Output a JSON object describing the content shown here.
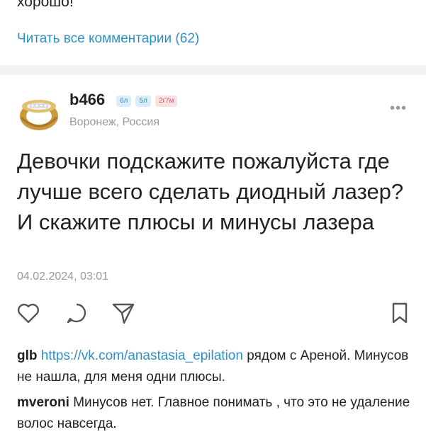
{
  "prev_post": {
    "comment_tail": "хорошо!",
    "read_all": "Читать все комментарии (62)"
  },
  "post": {
    "username": "b466",
    "badges": [
      "6л",
      "5л",
      "2г7м"
    ],
    "location": "Воронеж, Россия",
    "more_icon": "more-dots-icon",
    "text": "Девочки подскажите пожалуйста где лучше всего сделать диодный лазер? И скажите плюсы и минусы лазера",
    "date": "04.02.2024, 03:01",
    "actions": {
      "like_icon": "heart-icon",
      "comment_icon": "speech-bubble-icon",
      "share_icon": "send-icon",
      "bookmark_icon": "bookmark-icon"
    }
  },
  "comments": [
    {
      "author": "glb",
      "link": "https://vk.com/anastasia_epilation",
      "text": " рядом с Ареной. Минусов не нашла, для меня одни плюсы."
    },
    {
      "author": "mveroni",
      "text": " Минусов нет. Главное понимать , что это не удаление волос навсегда."
    }
  ],
  "colors": {
    "link": "#2f8fc9",
    "muted": "#9a9a9a",
    "separator": "#f1f1f1"
  }
}
